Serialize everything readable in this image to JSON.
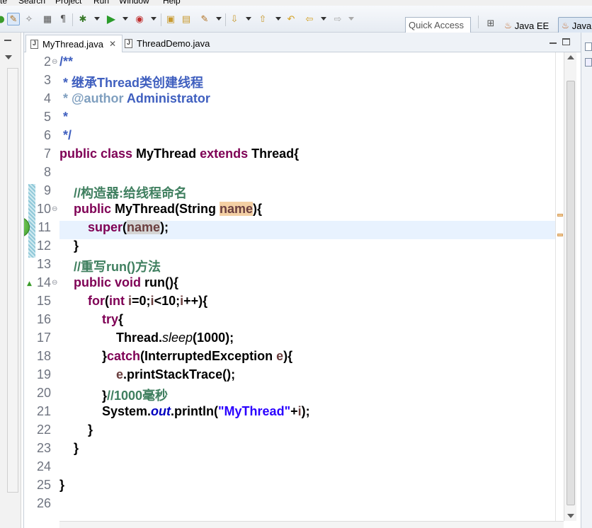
{
  "menu": [
    "te",
    "Search",
    "Project",
    "Run",
    "Window",
    "Help"
  ],
  "toolbar": {
    "quick_access_placeholder": "Quick Access",
    "perspectives": [
      "Java EE",
      "Java"
    ]
  },
  "tabs": [
    {
      "label": "MyThread.java",
      "active": true,
      "close": "✕"
    },
    {
      "label": "ThreadDemo.java",
      "active": false
    }
  ],
  "editor": {
    "line_numbers": [
      "2",
      "3",
      "4",
      "5",
      "6",
      "7",
      "8",
      "9",
      "10",
      "11",
      "12",
      "13",
      "14",
      "15",
      "16",
      "17",
      "18",
      "19",
      "20",
      "21",
      "22",
      "23",
      "24",
      "25",
      "26"
    ],
    "code": {
      "l2": "/**",
      "l3": " * 继承Thread类创建线程",
      "l4_tag": " * @author ",
      "l4_name": "Administrator",
      "l5": " *",
      "l6": " */",
      "l7_kw": "public class ",
      "l7_rest": "MyThread ",
      "l7_kw2": "extends ",
      "l7_tail": "Thread{",
      "l9": "//构造器:给线程命名",
      "l10_kw": "public ",
      "l10_mid": "MyThread(String ",
      "l10_var": "name",
      "l10_tail": "){",
      "l11_kw": "super",
      "l11_open": "(",
      "l11_var": "name",
      "l11_tail": ");",
      "l12": "}",
      "l13": "//重写run()方法",
      "l14_kw": "public void ",
      "l14_tail": "run(){",
      "l15_kw": "for",
      "l15_open": "(",
      "l15_kw2": "int ",
      "l15_i1": "i",
      "l15_mid1": "=0;",
      "l15_i2": "i",
      "l15_mid2": "<10;",
      "l15_i3": "i",
      "l15_tail": "++){",
      "l16_kw": "try",
      "l16_tail": "{",
      "l17_cls": "Thread.",
      "l17_m": "sleep",
      "l17_tail": "(1000);",
      "l18_open": "}",
      "l18_kw": "catch",
      "l18_mid": "(InterruptedException ",
      "l18_var": "e",
      "l18_tail": "){",
      "l19_var": "e",
      "l19_tail": ".printStackTrace();",
      "l20_br": "}",
      "l20_cm": "//1000毫秒",
      "l21_cls": "System.",
      "l21_fld": "out",
      "l21_mid": ".println(",
      "l21_str": "\"MyThread\"",
      "l21_plus": "+",
      "l21_var": "i",
      "l21_tail": ");",
      "l22": "}",
      "l23": "}",
      "l25": "}"
    }
  },
  "colors": {
    "keyword": "#7f0055",
    "comment": "#3f7f5f",
    "javadoc": "#3f5fbf",
    "string": "#2a00ff",
    "field": "#0000c0",
    "occurrence_write": "#f4d0a4",
    "current_line": "#e8f2fe"
  }
}
